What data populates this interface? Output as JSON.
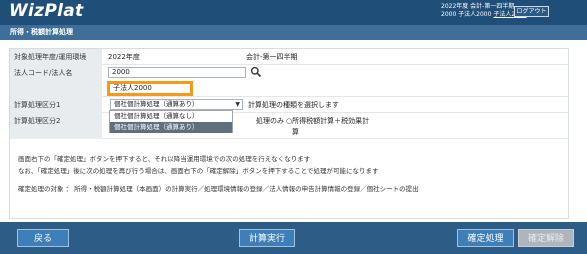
{
  "header": {
    "logo": "WizPlat",
    "user_line1": "2022年度 会計-第一四半期",
    "user_line2_prefix": "2000 子法人2000",
    "user_line2_link": "子法人2000",
    "logout_label": "ログアウト"
  },
  "page_title": "所得・税額計算処理",
  "form": {
    "rows": [
      {
        "label": "対象処理年度/運用環境",
        "value1": "2022年度",
        "value2": "会計-第一四半期"
      },
      {
        "label": "法人コード/法人名",
        "code_value": "2000"
      },
      {
        "label": "計算処理区分1",
        "selected": "個社個計算処理（通算あり）",
        "hint": "計算処理の種類を選択します"
      },
      {
        "label": "計算処理区分2",
        "radio1": "処理のみ",
        "radio2": "○所得税額計算＋税効果計",
        "radio2_cont": "算"
      }
    ],
    "corp_name": "子法人2000",
    "dropdown_options": [
      "個社個計算処理（通算なし）",
      "個社個計算処理（通算あり）"
    ]
  },
  "notes": [
    "画面右下の「確定処理」ボタンを押下すると、それ以降当運用環境での次の処理を行えなくなります",
    "なお、「確定処理」後に次の処理を再び行う場合は、画面右下の「確定解除」ボタンを押下することで処理が可能になります",
    "確定処理の対象 ： 所得・税額計算処理（本画面）の計算実行／処理環境情報の登録／法人情報の申告計算情報の登録／個社シートの提出"
  ],
  "footer": {
    "back": "戻る",
    "calc": "計算実行",
    "confirm": "確定処理",
    "cancel": "確定解除"
  },
  "icons": {
    "search": "search-icon",
    "dropdown": "chevron-down-icon"
  },
  "colors": {
    "header": "#1f4f78",
    "subheader": "#3f6f99",
    "footer": "#2d5d87",
    "highlight": "#f39a1a"
  }
}
